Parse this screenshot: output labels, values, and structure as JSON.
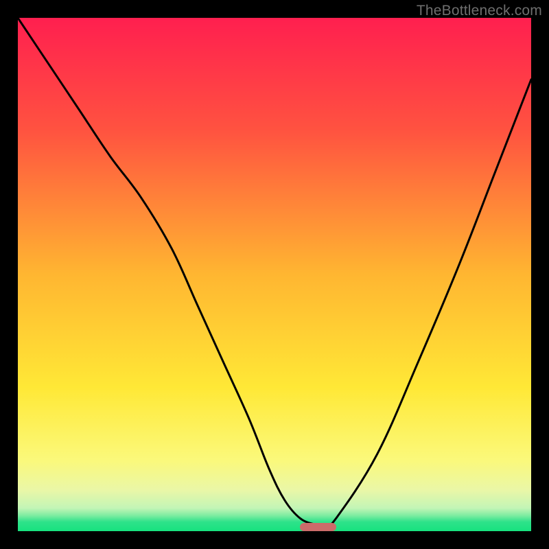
{
  "watermark": "TheBottleneck.com",
  "chart_data": {
    "type": "line",
    "title": "",
    "xlabel": "",
    "ylabel": "",
    "xlim": [
      0,
      100
    ],
    "ylim": [
      0,
      100
    ],
    "grid": false,
    "legend": false,
    "gradient_stops": [
      {
        "pct": 0,
        "color": "#ff1f4f"
      },
      {
        "pct": 22,
        "color": "#ff5340"
      },
      {
        "pct": 50,
        "color": "#ffb631"
      },
      {
        "pct": 72,
        "color": "#ffe836"
      },
      {
        "pct": 86,
        "color": "#fbf97a"
      },
      {
        "pct": 92,
        "color": "#eaf7a7"
      },
      {
        "pct": 95.5,
        "color": "#c3f5b6"
      },
      {
        "pct": 97,
        "color": "#7beca0"
      },
      {
        "pct": 98.2,
        "color": "#2ee28a"
      },
      {
        "pct": 100,
        "color": "#17e27f"
      }
    ],
    "series": [
      {
        "name": "bottleneck-curve",
        "x": [
          0,
          6,
          12,
          18,
          24,
          30,
          35,
          40,
          45,
          49,
          52,
          55,
          58,
          60,
          62,
          70,
          78,
          86,
          93,
          100
        ],
        "y": [
          100,
          91,
          82,
          73,
          65,
          55,
          44,
          33,
          22,
          12,
          6,
          2.5,
          1.3,
          1.3,
          2.5,
          15,
          33,
          52,
          70,
          88
        ]
      }
    ],
    "marker": {
      "x_start": 55,
      "x_end": 62,
      "y": 0.8,
      "color": "#cc6b6a"
    }
  }
}
